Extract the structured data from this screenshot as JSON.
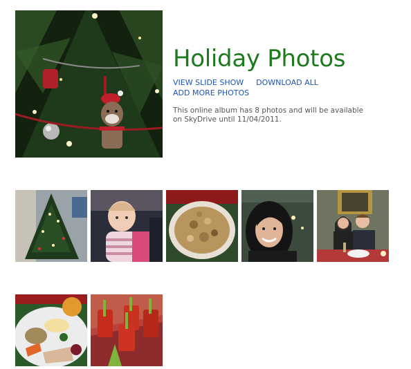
{
  "album": {
    "title": "Holiday Photos",
    "links": {
      "slideshow": "VIEW SLIDE SHOW",
      "download": "DOWNLOAD ALL",
      "add": "ADD MORE PHOTOS"
    },
    "description": "This online album has 8 photos and will be available on SkyDrive until 11/04/2011.",
    "colors": {
      "title": "#1e7a1e",
      "link": "#1a55b8",
      "text": "#555555"
    }
  },
  "cover_photo": {
    "icon": "christmas-tree-sock-monkey-photo"
  },
  "photos": [
    {
      "icon": "christmas-tree-photo"
    },
    {
      "icon": "baby-photo"
    },
    {
      "icon": "stuffing-dish-photo"
    },
    {
      "icon": "woman-smiling-photo"
    },
    {
      "icon": "couple-dinner-photo"
    },
    {
      "icon": "holiday-plate-photo"
    },
    {
      "icon": "bloody-mary-drinks-photo"
    }
  ]
}
